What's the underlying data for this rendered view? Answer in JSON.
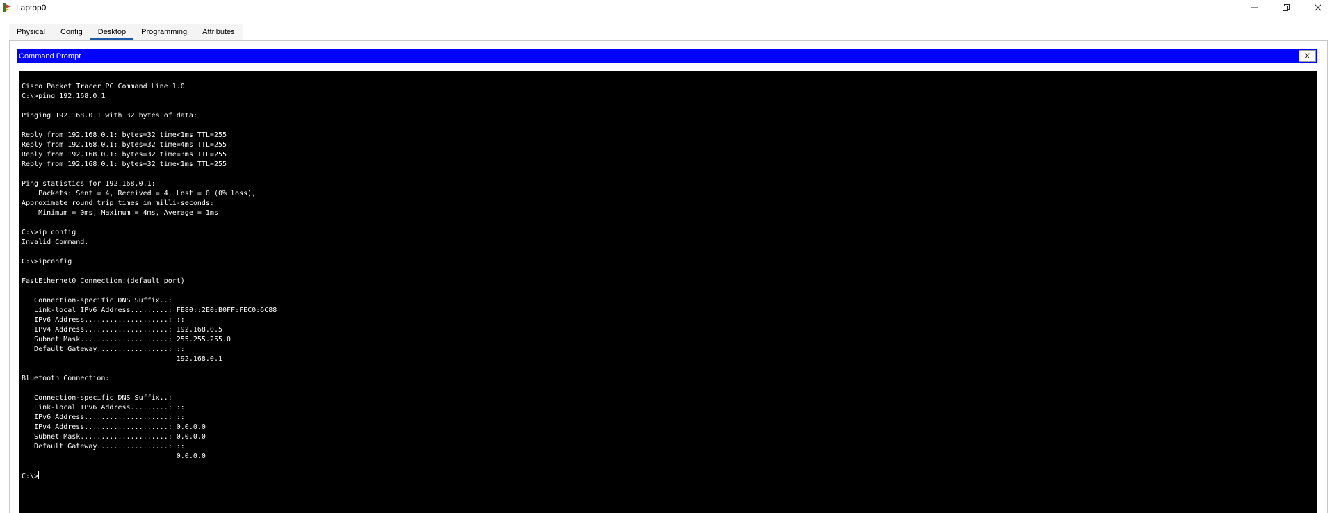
{
  "window": {
    "title": "Laptop0",
    "controls": {
      "minimize": "—",
      "restore": "❐",
      "close": "✕"
    }
  },
  "tabs": [
    {
      "label": "Physical",
      "active": false
    },
    {
      "label": "Config",
      "active": false
    },
    {
      "label": "Desktop",
      "active": true
    },
    {
      "label": "Programming",
      "active": false
    },
    {
      "label": "Attributes",
      "active": false
    }
  ],
  "command_prompt": {
    "title": "Command Prompt",
    "close_label": "X",
    "output": "Cisco Packet Tracer PC Command Line 1.0\nC:\\>ping 192.168.0.1\n\nPinging 192.168.0.1 with 32 bytes of data:\n\nReply from 192.168.0.1: bytes=32 time<1ms TTL=255\nReply from 192.168.0.1: bytes=32 time=4ms TTL=255\nReply from 192.168.0.1: bytes=32 time=3ms TTL=255\nReply from 192.168.0.1: bytes=32 time<1ms TTL=255\n\nPing statistics for 192.168.0.1:\n    Packets: Sent = 4, Received = 4, Lost = 0 (0% loss),\nApproximate round trip times in milli-seconds:\n    Minimum = 0ms, Maximum = 4ms, Average = 1ms\n\nC:\\>ip config\nInvalid Command.\n\nC:\\>ipconfig\n\nFastEthernet0 Connection:(default port)\n\n   Connection-specific DNS Suffix..: \n   Link-local IPv6 Address.........: FE80::2E0:B0FF:FEC0:6C88\n   IPv6 Address....................: ::\n   IPv4 Address....................: 192.168.0.5\n   Subnet Mask.....................: 255.255.255.0\n   Default Gateway.................: ::\n                                     192.168.0.1\n\nBluetooth Connection:\n\n   Connection-specific DNS Suffix..: \n   Link-local IPv6 Address.........: ::\n   IPv6 Address....................: ::\n   IPv4 Address....................: 0.0.0.0\n   Subnet Mask.....................: 0.0.0.0\n   Default Gateway.................: ::\n                                     0.0.0.0\n\n",
    "prompt": "C:\\>"
  },
  "colors": {
    "header_blue": "#0000ff",
    "terminal_bg": "#000000",
    "terminal_fg": "#ffffff",
    "tab_accent": "#1e5aa8"
  },
  "icons": {
    "app": "packet-tracer-laptop-icon"
  }
}
